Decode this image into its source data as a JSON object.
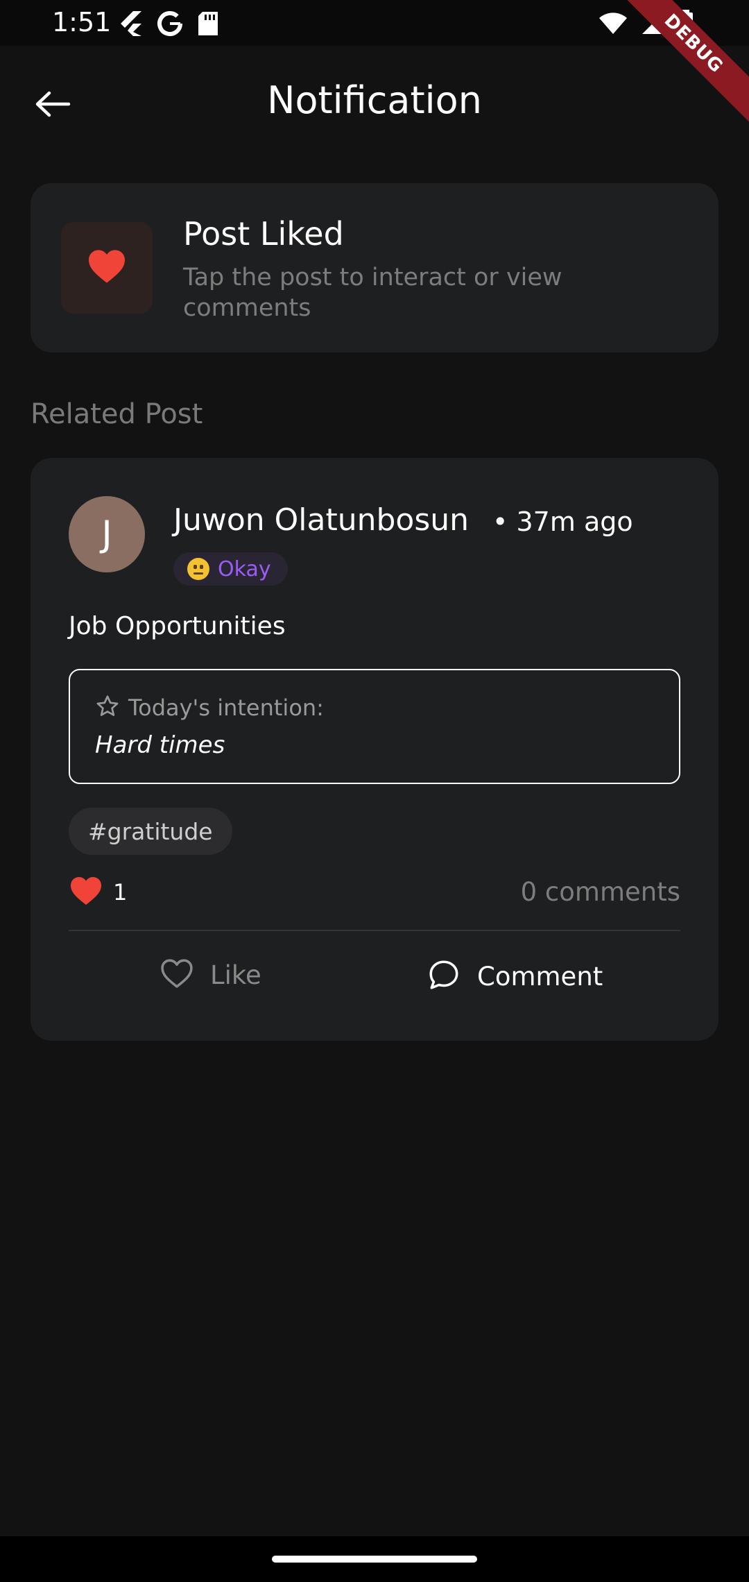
{
  "status_bar": {
    "time": "1:51",
    "left_icons": [
      "flutter-icon",
      "google-icon",
      "sd-card-icon"
    ],
    "right_icons": [
      "wifi-icon",
      "signal-icon",
      "battery-icon"
    ]
  },
  "debug_banner": "DEBUG",
  "app_bar": {
    "title": "Notification",
    "back_icon": "arrow-left-icon"
  },
  "notification": {
    "title": "Post Liked",
    "subtitle": "Tap the post to interact or view comments",
    "icon": "heart-icon",
    "icon_color": "#f04438"
  },
  "related_section": {
    "label": "Related Post"
  },
  "post": {
    "avatar_initial": "J",
    "author": "Juwon Olatunbosun",
    "time_ago": "• 37m ago",
    "mood": {
      "emoji": "neutral-face-icon",
      "label": "Okay",
      "color": "#9b5cf5"
    },
    "title": "Job Opportunities",
    "intention": {
      "label": "Today's intention:",
      "text": "Hard times",
      "icon": "star-outline-icon"
    },
    "tags": [
      "#gratitude"
    ],
    "likes_count": "1",
    "comments_count": "0 comments",
    "actions": {
      "like_label": "Like",
      "comment_label": "Comment"
    }
  },
  "colors": {
    "background": "#121212",
    "card": "#1e1f20",
    "accent_red": "#f04438",
    "accent_purple": "#9b5cf5"
  }
}
